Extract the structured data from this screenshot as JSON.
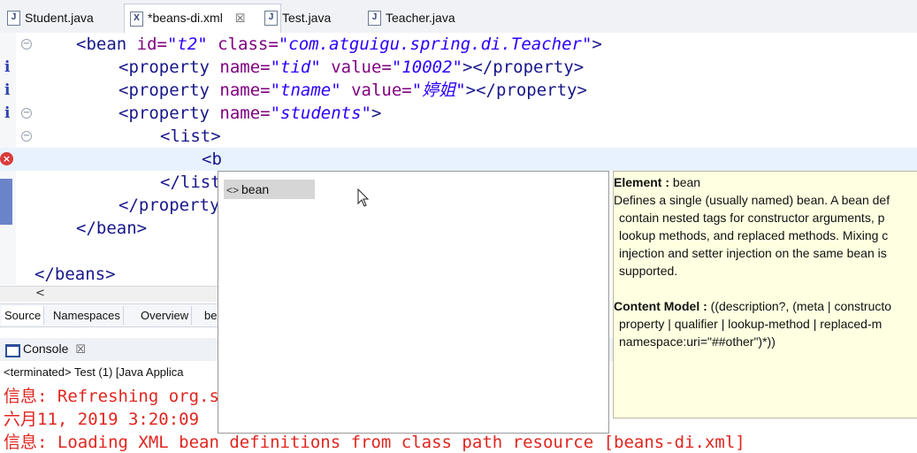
{
  "tabs": [
    {
      "label": "Student.java",
      "icon": "java-file-icon",
      "active": false
    },
    {
      "label": "*beans-di.xml",
      "icon": "xml-file-icon",
      "active": true
    },
    {
      "label": "Test.java",
      "icon": "java-file-icon",
      "active": false
    },
    {
      "label": "Teacher.java",
      "icon": "java-file-icon",
      "active": false
    }
  ],
  "editor": {
    "line1": {
      "open": "<bean ",
      "a1": "id=",
      "v1": "\"t2\"",
      "a2": " class=",
      "v2": "\"com.atguigu.spring.di.Teacher\"",
      "close": ">"
    },
    "line2": {
      "open": "<property ",
      "a1": "name=",
      "v1": "\"tid\"",
      "a2": " value=",
      "v2": "\"10002\"",
      "close": "></property>"
    },
    "line3": {
      "open": "<property ",
      "a1": "name=",
      "v1": "\"tname\"",
      "a2": " value=",
      "v2": "\"婷姐\"",
      "close": "></property>"
    },
    "line4": {
      "open": "<property ",
      "a1": "name=",
      "v1": "\"students\"",
      "close": ">"
    },
    "line5": "<list>",
    "line6": "<b",
    "line7": "</list>",
    "line8": "</property>",
    "line9": "</bean>",
    "line11": "</beans>"
  },
  "scroll_arrow": "<",
  "subtabs": [
    "Source",
    "Namespaces",
    "Overview",
    "be"
  ],
  "console": {
    "title": "Console",
    "status": "<terminated> Test (1) [Java Applica",
    "lines": [
      "信息: Refreshing org.s",
      "六月11, 2019 3:20:09 ",
      "信息: Loading XML bean definitions from class path resource [beans-di.xml]"
    ]
  },
  "assist": {
    "items": [
      {
        "label": "bean",
        "icon": "<>"
      }
    ]
  },
  "doc": {
    "element_label": "Element :",
    "element_value": " bean",
    "desc_lines": [
      "Defines a single (usually named) bean. A bean def",
      "contain nested tags for constructor arguments, p",
      "lookup methods, and replaced methods. Mixing c",
      "injection and setter injection on the same bean is",
      "supported."
    ],
    "content_label": "Content Model :",
    "content_value": " ((description?, (meta | constructo",
    "content_lines": [
      "property | qualifier | lookup-method | replaced-m",
      "namespace:uri=\"##other\")*))"
    ]
  }
}
